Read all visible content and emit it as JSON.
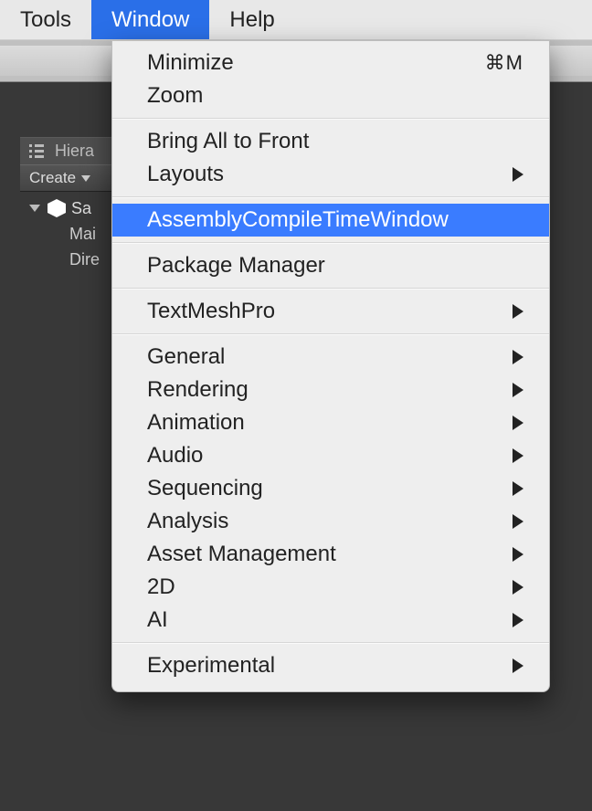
{
  "menubar": {
    "items": [
      {
        "label": "Tools"
      },
      {
        "label": "Window"
      },
      {
        "label": "Help"
      }
    ],
    "activeIndex": 1
  },
  "dropdown": {
    "groups": [
      [
        {
          "label": "Minimize",
          "shortcut": "⌘M",
          "submenu": false
        },
        {
          "label": "Zoom",
          "submenu": false
        }
      ],
      [
        {
          "label": "Bring All to Front",
          "submenu": false
        },
        {
          "label": "Layouts",
          "submenu": true
        }
      ],
      [
        {
          "label": "AssemblyCompileTimeWindow",
          "submenu": false,
          "selected": true
        }
      ],
      [
        {
          "label": "Package Manager",
          "submenu": false
        }
      ],
      [
        {
          "label": "TextMeshPro",
          "submenu": true
        }
      ],
      [
        {
          "label": "General",
          "submenu": true
        },
        {
          "label": "Rendering",
          "submenu": true
        },
        {
          "label": "Animation",
          "submenu": true
        },
        {
          "label": "Audio",
          "submenu": true
        },
        {
          "label": "Sequencing",
          "submenu": true
        },
        {
          "label": "Analysis",
          "submenu": true
        },
        {
          "label": "Asset Management",
          "submenu": true
        },
        {
          "label": "2D",
          "submenu": true
        },
        {
          "label": "AI",
          "submenu": true
        }
      ],
      [
        {
          "label": "Experimental",
          "submenu": true
        }
      ]
    ]
  },
  "hierarchyPanel": {
    "tabLabel": "Hiera",
    "createLabel": "Create",
    "tree": {
      "root": {
        "label": "Sa"
      },
      "children": [
        {
          "label": "Mai"
        },
        {
          "label": "Dire"
        }
      ]
    }
  }
}
